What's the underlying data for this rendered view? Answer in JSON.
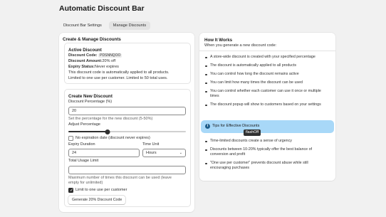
{
  "page": {
    "title": "Automatic Discount Bar"
  },
  "tabs": [
    {
      "label": "Discount Bar Settings",
      "active": false
    },
    {
      "label": "Manage Discounts",
      "active": true
    }
  ],
  "create_manage": {
    "title": "Create & Manage Discounts",
    "active_discount": {
      "heading": "Active Discount",
      "code_label": "Discount Code:",
      "code_value": "PDSNNQOO",
      "amount_label": "Discount Amount:",
      "amount_value": "20% off",
      "expiry_label": "Expiry Status:",
      "expiry_value": "Never expires",
      "note1": "This discount code is automatically applied to all products.",
      "note2": "Limited to one use per customer. Limited to 50 total uses."
    },
    "new_discount": {
      "heading": "Create New Discount",
      "percentage_label": "Discount Percentage (%)",
      "percentage_value": "20",
      "percentage_help": "Set the percentage for the new discount (5-50%)",
      "adjust_label": "Adjust Percentage",
      "slider_fraction": 0.333,
      "no_expiration_label": "No expiration date (discount never expires)",
      "no_expiration_checked": false,
      "expiry_duration_label": "Expiry Duration",
      "expiry_duration_value": "24",
      "time_unit_label": "Time Unit",
      "time_unit_value": "Hours",
      "usage_limit_label": "Total Usage Limit",
      "usage_limit_value": "",
      "usage_help1": "Maximum number of times this discount can be used (leave",
      "usage_help2": "empty for unlimited)",
      "one_use_label": "Limit to one use per customer",
      "one_use_checked": true,
      "generate_button": "Generate 20% Discount Code"
    }
  },
  "how_it_works": {
    "title": "How It Works",
    "intro": "When you generate a new discount code:",
    "items": [
      "A store-wide discount is created with your specified percentage",
      "The discount is automatically applied to all products",
      "You can control how long the discount remains active",
      "You can limit how many times the discount can be used",
      "You can control whether each customer can use it once or multiple",
      "times",
      "The discount popup will show to customers based on your settings"
    ]
  },
  "tips": {
    "title": "Tips for Effective Discounts",
    "tooltip": "flashOff",
    "items": [
      "Time-limited discounts create a sense of urgency",
      "Discounts between 10-20% typically offer the best balance of",
      "conversion and profit",
      "\"One use per customer\" prevents discount abuse while still",
      "encouraging purchases"
    ]
  },
  "colors": {
    "banner": "#a8d8f8",
    "page_bg": "#f1f1f1",
    "accent": "#303030"
  }
}
